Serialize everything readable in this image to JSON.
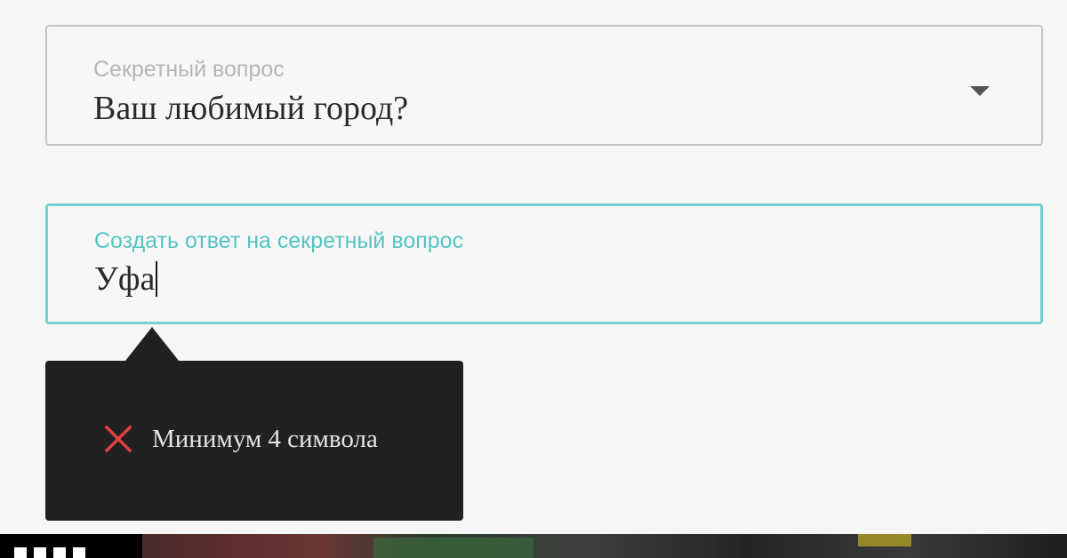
{
  "question_field": {
    "label": "Секретный вопрос",
    "value": "Ваш любимый город?",
    "icon": "chevron-down-icon"
  },
  "answer_field": {
    "label": "Создать ответ на секретный вопрос",
    "value": "Уфа",
    "focused": true
  },
  "validation_tooltip": {
    "icon": "close-icon",
    "message": "Минимум 4 символа",
    "status": "error"
  },
  "colors": {
    "accent": "#55c4c2",
    "focus_border": "#6fd3cf",
    "error": "#e0403f",
    "tooltip_bg": "#212121",
    "page_bg": "#f6f6f6"
  }
}
